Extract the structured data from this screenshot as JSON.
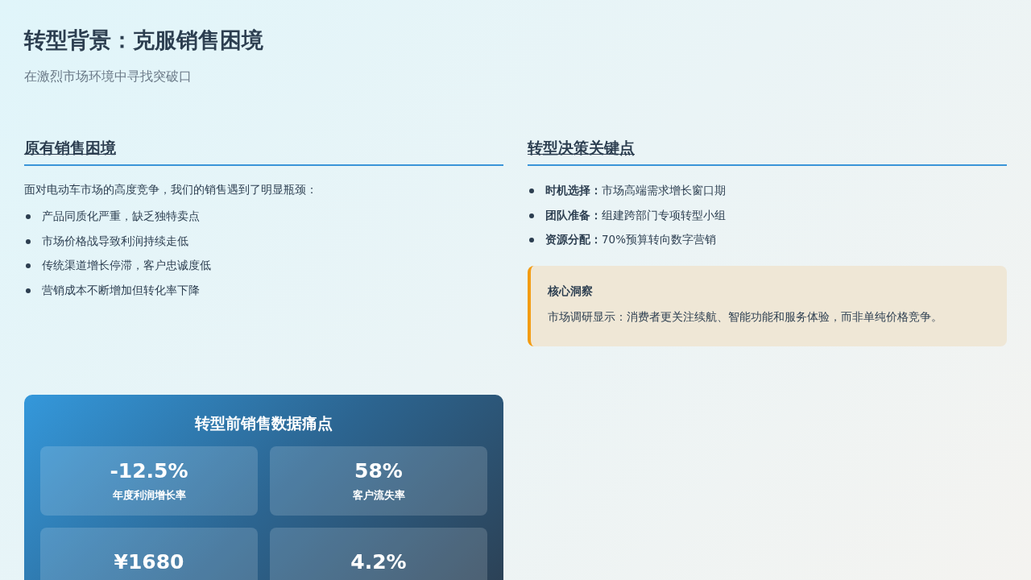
{
  "header": {
    "title": "转型背景：克服销售困境",
    "subtitle": "在激烈市场环境中寻找突破口"
  },
  "left": {
    "heading": "原有销售困境",
    "intro": "面对电动车市场的高度竞争，我们的销售遇到了明显瓶颈：",
    "bullets": [
      "产品同质化严重，缺乏独特卖点",
      "市场价格战导致利润持续走低",
      "传统渠道增长停滞，客户忠诚度低",
      "营销成本不断增加但转化率下降"
    ]
  },
  "right": {
    "heading": "转型决策关键点",
    "bullets": [
      {
        "label": "时机选择：",
        "text": "市场高端需求增长窗口期"
      },
      {
        "label": "团队准备：",
        "text": "组建跨部门专项转型小组"
      },
      {
        "label": "资源分配：",
        "text": "70%预算转向数字营销"
      }
    ],
    "insight": {
      "title": "核心洞察",
      "text": "市场调研显示：消费者更关注续航、智能功能和服务体验，而非单纯价格竞争。"
    }
  },
  "stats_panel": {
    "title": "转型前销售数据痛点",
    "stats": [
      {
        "value": "-12.5%",
        "label": "年度利润增长率"
      },
      {
        "value": "58%",
        "label": "客户流失率"
      },
      {
        "value": "¥1680"
      },
      {
        "value": "4.2%"
      }
    ]
  }
}
